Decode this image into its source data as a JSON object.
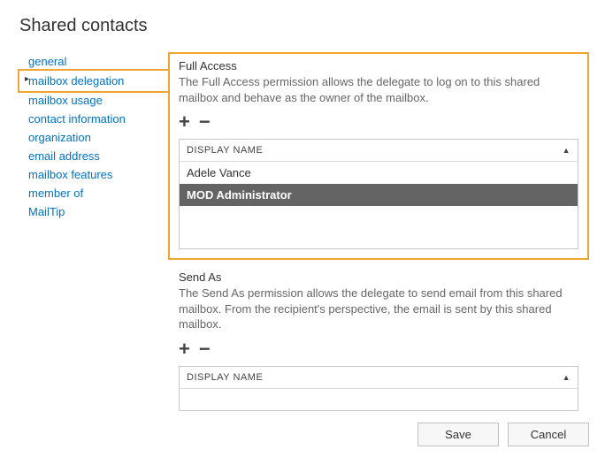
{
  "title": "Shared contacts",
  "sidebar": {
    "items": [
      {
        "label": "general",
        "selected": false
      },
      {
        "label": "mailbox delegation",
        "selected": true
      },
      {
        "label": "mailbox usage",
        "selected": false
      },
      {
        "label": "contact information",
        "selected": false
      },
      {
        "label": "organization",
        "selected": false
      },
      {
        "label": "email address",
        "selected": false
      },
      {
        "label": "mailbox features",
        "selected": false
      },
      {
        "label": "member of",
        "selected": false
      },
      {
        "label": "MailTip",
        "selected": false
      }
    ]
  },
  "fullAccess": {
    "title": "Full Access",
    "desc": "The Full Access permission allows the delegate to log on to this shared mailbox and behave as the owner of the mailbox.",
    "columnHeader": "DISPLAY NAME",
    "rows": [
      {
        "name": "Adele Vance",
        "selected": false
      },
      {
        "name": "MOD Administrator",
        "selected": true
      }
    ]
  },
  "sendAs": {
    "title": "Send As",
    "desc": "The Send As permission allows the delegate to send email from this shared mailbox. From the recipient's perspective, the email is sent by this shared mailbox.",
    "columnHeader": "DISPLAY NAME",
    "rows": []
  },
  "buttons": {
    "save": "Save",
    "cancel": "Cancel"
  },
  "icons": {
    "plus": "+",
    "minus": "−",
    "sortAsc": "▲"
  }
}
